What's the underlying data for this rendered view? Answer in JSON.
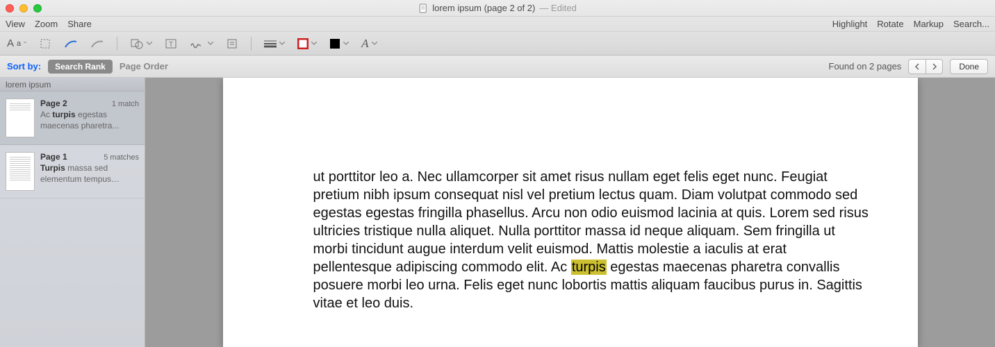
{
  "window": {
    "title": "lorem ipsum (page 2 of 2)",
    "status": "— Edited"
  },
  "menu": {
    "left": [
      "View",
      "Zoom",
      "Share"
    ],
    "right": [
      "Highlight",
      "Rotate",
      "Markup",
      "Search..."
    ]
  },
  "searchbar": {
    "sort_label": "Sort by:",
    "option_rank": "Search Rank",
    "option_page": "Page Order",
    "found": "Found on 2 pages",
    "done": "Done"
  },
  "sidebar": {
    "heading": "lorem ipsum",
    "results": [
      {
        "page": "Page 2",
        "matches": "1 match",
        "snippet_pre": "Ac ",
        "snippet_hit": "turpis",
        "snippet_post": " egestas maecenas pharetra..."
      },
      {
        "page": "Page 1",
        "matches": "5 matches",
        "snippet_pre": "",
        "snippet_hit": "Turpis",
        "snippet_post": " massa sed elementum tempus egestas sed sed risu..."
      }
    ]
  },
  "document": {
    "body_pre": "ut porttitor leo a. Nec ullamcorper sit amet risus nullam eget felis eget nunc. Feugiat pretium nibh ipsum consequat nisl vel pretium lectus quam. Diam volutpat commodo sed egestas egestas fringilla phasellus. Arcu non odio euismod lacinia at quis. Lorem sed risus ultricies tristique nulla aliquet. Nulla porttitor massa id neque aliquam. Sem fringilla ut morbi tincidunt augue interdum velit euismod. Mattis molestie a iaculis at erat pellentesque adipiscing commodo elit. Ac ",
    "body_hit": "turpis",
    "body_post": " egestas maecenas pharetra convallis posuere morbi leo urna. Felis eget nunc lobortis mattis aliquam faucibus purus in. Sagittis vitae et leo duis."
  }
}
